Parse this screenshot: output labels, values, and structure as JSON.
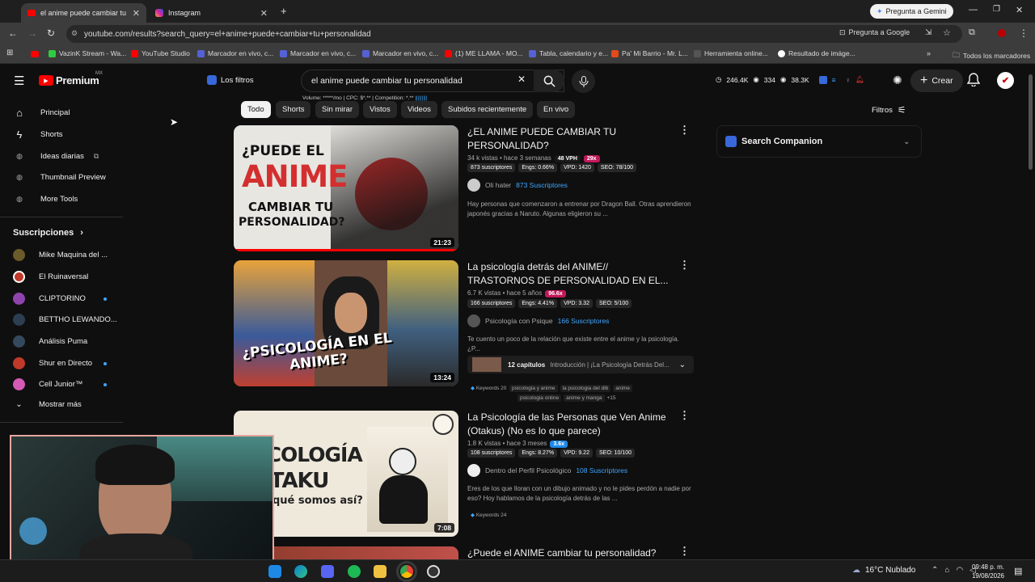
{
  "browser": {
    "tabs": [
      {
        "title": "el anime puede cambiar tu pers",
        "active": true
      },
      {
        "title": "Instagram",
        "active": false
      }
    ],
    "gemini_label": "Pregunta a Gemini",
    "url": "youtube.com/results?search_query=el+anime+puede+cambiar+tu+personalidad",
    "ask_google": "Pregunta a Google",
    "bookmarks": [
      "VazinK Stream - Wa...",
      "YouTube Studio",
      "Marcador en vivo, c...",
      "Marcador en vivo, c...",
      "Marcador en vivo, c...",
      "(1) ME LLAMA - MO...",
      "Tabla, calendario y e...",
      "Pa' Mi Barrio - Mr. L...",
      "Herramienta online...",
      "Resultado de imáge..."
    ],
    "all_bookmarks": "Todos los marcadores"
  },
  "header": {
    "logo": "Premium",
    "region": "MX",
    "filters_label": "Los filtros",
    "search_value": "el anime puede cambiar tu personalidad",
    "volume_line": "Volume: *****/mo | CPC: $*.** | Competition: *.**",
    "ext_stats": [
      "246.4K",
      "334",
      "38.3K"
    ],
    "create_label": "Crear"
  },
  "chips": [
    "Todo",
    "Shorts",
    "Sin mirar",
    "Vistos",
    "Videos",
    "Subidos recientemente",
    "En vivo"
  ],
  "filters_btn": "Filtros",
  "sidebar": {
    "main": [
      "Principal",
      "Shorts",
      "Ideas diarias",
      "Thumbnail Preview",
      "More Tools"
    ],
    "subs_header": "Suscripciones",
    "subs": [
      "Mike Maquina del ...",
      "El Ruinaversal",
      "CLIPTORINO",
      "BETTHO LEWANDO...",
      "Análisis Puma",
      "Shur en Directo",
      "Cell Junior™"
    ],
    "show_more": "Mostrar más"
  },
  "companion": {
    "title": "Search Companion"
  },
  "videos": [
    {
      "title": "¿EL ANIME PUEDE CAMBIAR TU PERSONALIDAD?",
      "meta": "34 k vistas • hace 3 semanas",
      "vph": "48 VPH",
      "mult": "29x",
      "stats": [
        "873 suscriptores",
        "Engs: 0.66%",
        "VPD: 1420",
        "SEO: 78/100"
      ],
      "channel": "Oli hater",
      "subs": "873 Suscriptores",
      "desc": "Hay personas que comenzaron a entrenar por Dragon Ball. Otras aprendieron japonés gracias a Naruto. Algunas eligieron su ...",
      "duration": "21:23",
      "thumb_lines": [
        "¿PUEDE EL",
        "ANIME",
        "CAMBIAR TU",
        "PERSONALIDAD?"
      ]
    },
    {
      "title": "La psicología detrás del ANIME// TRASTORNOS DE PERSONALIDAD EN EL...",
      "meta": "6.7 K vistas • hace 5 años",
      "mult": "96.6x",
      "stats": [
        "166 suscriptores",
        "Engs: 4.41%",
        "VPD: 3.32",
        "SEO: 5/100"
      ],
      "channel": "Psicología con Psique",
      "subs": "166 Suscriptores",
      "desc": "Te cuento un poco de la relación que existe entre el anime y la psicología. ¿P...",
      "chapters": "12 capítulos",
      "chapter_intro": "Introducción | ¡La Psicología Detrás Del...",
      "keywords_label": "Keywords",
      "keywords_count": "20",
      "keywords": [
        "psicologia y anime",
        "la psicologia del dib",
        "anime",
        "psicologia online",
        "anime y manga"
      ],
      "keywords_more": "+15",
      "duration": "13:24",
      "thumb_text": "¿PSICOLOGÍA EN EL ANIME?"
    },
    {
      "title": "La Psicología de las Personas que Ven Anime (Otakus) (No es lo que parece)",
      "meta": "1.8 K vistas • hace 3 meses",
      "mult": "3.6x",
      "stats": [
        "108 suscriptores",
        "Engs: 8.27%",
        "VPD: 9.22",
        "SEO: 10/100"
      ],
      "channel": "Dentro del Perfil Psicológico",
      "subs": "108 Suscriptores",
      "desc": "Eres de los que lloran con un dibujo animado y no le pides perdón a nadie por eso? Hoy hablamos de la psicología detrás de las ...",
      "keywords_label": "Keywords",
      "keywords_count": "24",
      "duration": "7:08",
      "thumb_lines": [
        "PSICOLOGÍA",
        "L OTAKU",
        "qué somos así?"
      ]
    },
    {
      "title": "¿Puede el ANIME cambiar tu personalidad?"
    }
  ],
  "taskbar": {
    "weather": "16°C  Nublado",
    "time": "09:48 p. m.",
    "date": "19/08/2026"
  }
}
